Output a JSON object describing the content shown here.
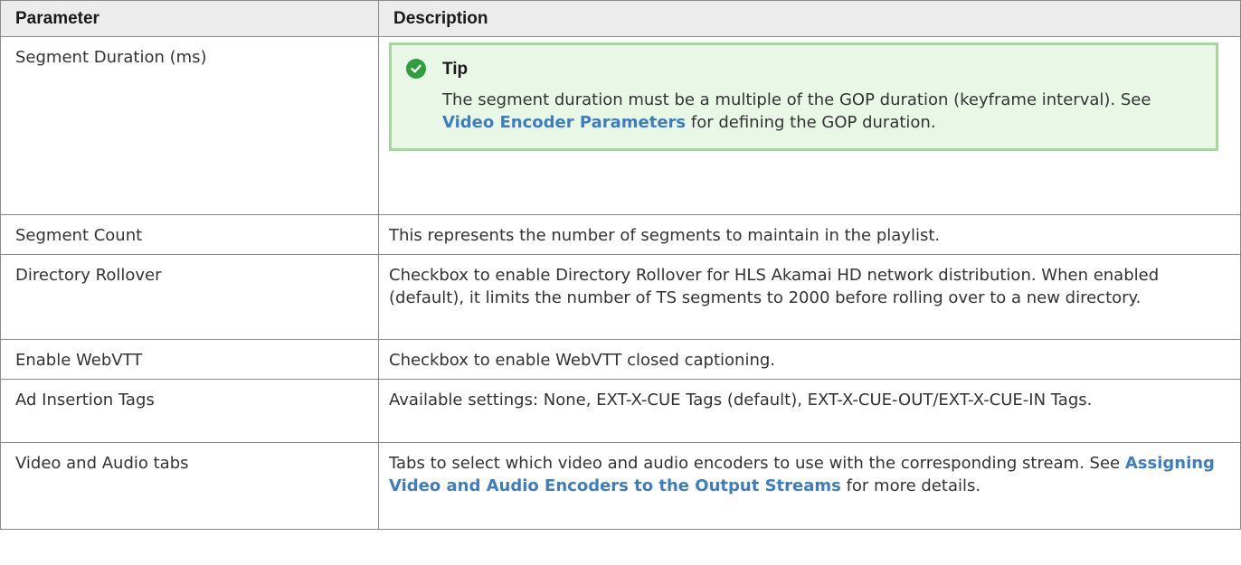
{
  "table": {
    "headers": {
      "parameter": "Parameter",
      "description": "Description"
    },
    "rows": [
      {
        "param": "Segment Duration (ms)",
        "tip": {
          "title": "Tip",
          "text_1": "The segment duration must be a multiple of the GOP duration (keyframe interval). See ",
          "link": "Video Encoder Parameters",
          "text_2": " for defining the GOP duration."
        }
      },
      {
        "param": "Segment Count",
        "desc": "This represents the number of segments to maintain in the playlist."
      },
      {
        "param": "Directory Rollover",
        "desc": "Checkbox to enable Directory Rollover for HLS Akamai HD network distribution. When enabled (default), it limits the number of TS segments to 2000 before rolling over to a new directory."
      },
      {
        "param": "Enable WebVTT",
        "desc": "Checkbox to enable WebVTT closed captioning."
      },
      {
        "param": "Ad Insertion Tags",
        "desc": "Available settings: None, EXT-X-CUE Tags (default), EXT-X-CUE-OUT/EXT-X-CUE-IN Tags."
      },
      {
        "param": "Video and Audio tabs",
        "desc_1": "Tabs to select which video and audio encoders to use with the corresponding stream. See ",
        "link": "Assigning Video and Audio Encoders to the Output Streams",
        "desc_2": " for more details."
      }
    ]
  },
  "colors": {
    "header_bg": "#ececec",
    "tip_bg": "#e8f7e6",
    "tip_border": "#a4d89b",
    "tip_icon": "#2f9e3e",
    "link": "#3d7dc0"
  },
  "icons": {
    "tip": "check-circle-icon"
  }
}
